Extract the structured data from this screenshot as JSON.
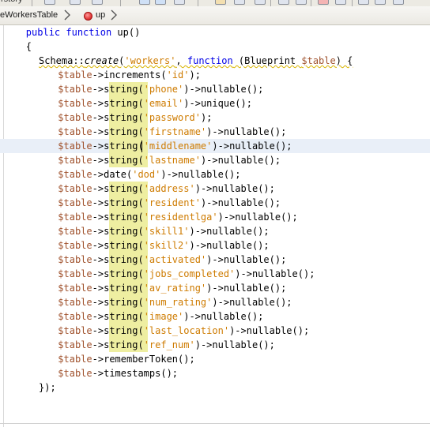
{
  "toolbar": {
    "partial_label": "rstory"
  },
  "breadcrumb": {
    "items": [
      {
        "label": "eWorkersTable"
      },
      {
        "label": "up"
      }
    ]
  },
  "editor": {
    "lines": [
      {
        "indent": 3,
        "tokens": [
          {
            "t": "kw",
            "v": "public function "
          },
          {
            "t": "plain",
            "v": "up()"
          }
        ]
      },
      {
        "indent": 3,
        "tokens": [
          {
            "t": "plain",
            "v": "{"
          }
        ]
      },
      {
        "indent": 5,
        "tokens": [
          {
            "t": "plain",
            "v": "Schema::"
          },
          {
            "t": "plain",
            "it": true,
            "v": "create"
          },
          {
            "t": "plain",
            "v": "("
          },
          {
            "t": "str",
            "v": "'workers'"
          },
          {
            "t": "plain",
            "v": ", "
          },
          {
            "t": "kw",
            "v": "function"
          },
          {
            "t": "plain",
            "v": " (Blueprint "
          },
          {
            "t": "var",
            "v": "$table"
          },
          {
            "t": "plain",
            "v": ") {"
          }
        ],
        "squiggle": true
      },
      {
        "indent": 8,
        "tokens": [
          {
            "t": "var",
            "v": "$table"
          },
          {
            "t": "plain",
            "v": "->increments("
          },
          {
            "t": "str",
            "v": "'id'"
          },
          {
            "t": "plain",
            "v": ");"
          }
        ]
      },
      {
        "indent": 8,
        "occ": true,
        "tokens": [
          {
            "t": "var",
            "v": "$table"
          },
          {
            "t": "plain",
            "v": "->string("
          },
          {
            "t": "str",
            "v": "'phone'"
          },
          {
            "t": "plain",
            "v": ")->nullable();"
          }
        ]
      },
      {
        "indent": 8,
        "occ": true,
        "tokens": [
          {
            "t": "var",
            "v": "$table"
          },
          {
            "t": "plain",
            "v": "->string("
          },
          {
            "t": "str",
            "v": "'email'"
          },
          {
            "t": "plain",
            "v": ")->unique();"
          }
        ]
      },
      {
        "indent": 8,
        "occ": true,
        "tokens": [
          {
            "t": "var",
            "v": "$table"
          },
          {
            "t": "plain",
            "v": "->string("
          },
          {
            "t": "str",
            "v": "'password'"
          },
          {
            "t": "plain",
            "v": ");"
          }
        ]
      },
      {
        "indent": 8,
        "occ": true,
        "tokens": [
          {
            "t": "var",
            "v": "$table"
          },
          {
            "t": "plain",
            "v": "->string("
          },
          {
            "t": "str",
            "v": "'firstname'"
          },
          {
            "t": "plain",
            "v": ")->nullable();"
          }
        ]
      },
      {
        "indent": 8,
        "occ": true,
        "current": true,
        "tokens": [
          {
            "t": "var",
            "v": "$table"
          },
          {
            "t": "plain",
            "v": "->string("
          },
          {
            "t": "str",
            "v": "'middlename'"
          },
          {
            "t": "plain",
            "v": ")->nullable();"
          }
        ]
      },
      {
        "indent": 8,
        "occ": true,
        "tokens": [
          {
            "t": "var",
            "v": "$table"
          },
          {
            "t": "plain",
            "v": "->string("
          },
          {
            "t": "str",
            "v": "'lastname'"
          },
          {
            "t": "plain",
            "v": ")->nullable();"
          }
        ]
      },
      {
        "indent": 8,
        "tokens": [
          {
            "t": "var",
            "v": "$table"
          },
          {
            "t": "plain",
            "v": "->date("
          },
          {
            "t": "str",
            "v": "'dod'"
          },
          {
            "t": "plain",
            "v": ")->nullable();"
          }
        ]
      },
      {
        "indent": 8,
        "occ": true,
        "tokens": [
          {
            "t": "var",
            "v": "$table"
          },
          {
            "t": "plain",
            "v": "->string("
          },
          {
            "t": "str",
            "v": "'address'"
          },
          {
            "t": "plain",
            "v": ")->nullable();"
          }
        ]
      },
      {
        "indent": 8,
        "occ": true,
        "tokens": [
          {
            "t": "var",
            "v": "$table"
          },
          {
            "t": "plain",
            "v": "->string("
          },
          {
            "t": "str",
            "v": "'resident'"
          },
          {
            "t": "plain",
            "v": ")->nullable();"
          }
        ]
      },
      {
        "indent": 8,
        "occ": true,
        "tokens": [
          {
            "t": "var",
            "v": "$table"
          },
          {
            "t": "plain",
            "v": "->string("
          },
          {
            "t": "str",
            "v": "'residentlga'"
          },
          {
            "t": "plain",
            "v": ")->nullable();"
          }
        ]
      },
      {
        "indent": 8,
        "occ": true,
        "tokens": [
          {
            "t": "var",
            "v": "$table"
          },
          {
            "t": "plain",
            "v": "->string("
          },
          {
            "t": "str",
            "v": "'skill1'"
          },
          {
            "t": "plain",
            "v": ")->nullable();"
          }
        ]
      },
      {
        "indent": 8,
        "occ": true,
        "tokens": [
          {
            "t": "var",
            "v": "$table"
          },
          {
            "t": "plain",
            "v": "->string("
          },
          {
            "t": "str",
            "v": "'skill2'"
          },
          {
            "t": "plain",
            "v": ")->nullable();"
          }
        ]
      },
      {
        "indent": 8,
        "occ": true,
        "tokens": [
          {
            "t": "var",
            "v": "$table"
          },
          {
            "t": "plain",
            "v": "->string("
          },
          {
            "t": "str",
            "v": "'activated'"
          },
          {
            "t": "plain",
            "v": ")->nullable();"
          }
        ]
      },
      {
        "indent": 8,
        "occ": true,
        "tokens": [
          {
            "t": "var",
            "v": "$table"
          },
          {
            "t": "plain",
            "v": "->string("
          },
          {
            "t": "str",
            "v": "'jobs_completed'"
          },
          {
            "t": "plain",
            "v": ")->nullable();"
          }
        ]
      },
      {
        "indent": 8,
        "occ": true,
        "tokens": [
          {
            "t": "var",
            "v": "$table"
          },
          {
            "t": "plain",
            "v": "->string("
          },
          {
            "t": "str",
            "v": "'av_rating'"
          },
          {
            "t": "plain",
            "v": ")->nullable();"
          }
        ]
      },
      {
        "indent": 8,
        "occ": true,
        "tokens": [
          {
            "t": "var",
            "v": "$table"
          },
          {
            "t": "plain",
            "v": "->string("
          },
          {
            "t": "str",
            "v": "'num_rating'"
          },
          {
            "t": "plain",
            "v": ")->nullable();"
          }
        ]
      },
      {
        "indent": 8,
        "occ": true,
        "tokens": [
          {
            "t": "var",
            "v": "$table"
          },
          {
            "t": "plain",
            "v": "->string("
          },
          {
            "t": "str",
            "v": "'image'"
          },
          {
            "t": "plain",
            "v": ")->nullable();"
          }
        ]
      },
      {
        "indent": 8,
        "occ": true,
        "tokens": [
          {
            "t": "var",
            "v": "$table"
          },
          {
            "t": "plain",
            "v": "->string("
          },
          {
            "t": "str",
            "v": "'last_location'"
          },
          {
            "t": "plain",
            "v": ")->nullable();"
          }
        ]
      },
      {
        "indent": 8,
        "occ": true,
        "tokens": [
          {
            "t": "var",
            "v": "$table"
          },
          {
            "t": "plain",
            "v": "->string("
          },
          {
            "t": "str",
            "v": "'ref_num'"
          },
          {
            "t": "plain",
            "v": ")->nullable();"
          }
        ]
      },
      {
        "indent": 8,
        "tokens": [
          {
            "t": "var",
            "v": "$table"
          },
          {
            "t": "plain",
            "v": "->rememberToken();"
          }
        ]
      },
      {
        "indent": 8,
        "tokens": [
          {
            "t": "var",
            "v": "$table"
          },
          {
            "t": "plain",
            "v": "->timestamps();"
          }
        ]
      },
      {
        "indent": 5,
        "tokens": [
          {
            "t": "plain",
            "v": "});"
          }
        ]
      }
    ]
  },
  "colors": {
    "keyword": "#0000e6",
    "variable": "#a0522d",
    "string": "#ce7b00",
    "occurrence_highlight": "#eeeea1",
    "current_line": "#e9eff8"
  }
}
